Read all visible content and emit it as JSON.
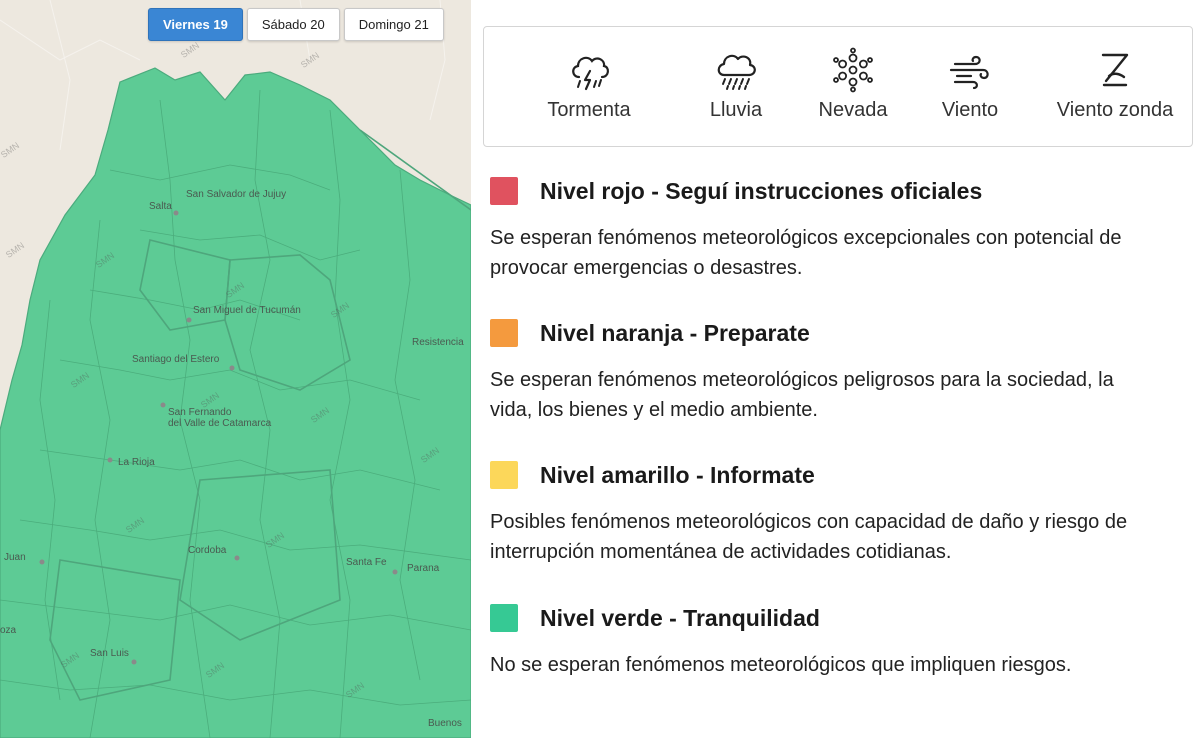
{
  "map": {
    "fill_color": "#5dcb95",
    "land_color": "#ede8df",
    "watermark": "SMN",
    "cities": [
      "San Salvador de Jujuy",
      "Salta",
      "San Miguel de Tucumán",
      "Resistencia",
      "Santiago del Estero",
      "San Fernando",
      "del Valle de Catamarca",
      "La Rioja",
      "Cordoba",
      "Santa Fe",
      "Parana",
      "Juan",
      "oza",
      "San Luis",
      "Buenos"
    ]
  },
  "date_tabs": [
    {
      "label": "Viernes 19",
      "active": true
    },
    {
      "label": "Sábado 20",
      "active": false
    },
    {
      "label": "Domingo 21",
      "active": false
    }
  ],
  "phenomena": [
    {
      "label": "Tormenta",
      "icon": "storm-icon"
    },
    {
      "label": "Lluvia",
      "icon": "rain-icon"
    },
    {
      "label": "Nevada",
      "icon": "snow-icon"
    },
    {
      "label": "Viento",
      "icon": "wind-icon"
    },
    {
      "label": "Viento zonda",
      "icon": "zonda-wind-icon"
    }
  ],
  "levels": [
    {
      "title": "Nivel rojo - Seguí instrucciones oficiales",
      "color": "#e0525f",
      "desc_line1": "Se esperan fenómenos meteorológicos excepcionales con potencial de",
      "desc_line2": "provocar emergencias o desastres."
    },
    {
      "title": "Nivel naranja - Preparate",
      "color": "#f49a3e",
      "desc_line1": "Se esperan fenómenos meteorológicos peligrosos para la sociedad, la",
      "desc_line2": "vida, los bienes y el medio ambiente."
    },
    {
      "title": "Nivel amarillo - Informate",
      "color": "#fcd75a",
      "desc_line1": "Posibles fenómenos meteorológicos con capacidad de daño y riesgo de",
      "desc_line2": "interrupción momentánea de actividades cotidianas."
    },
    {
      "title": "Nivel verde - Tranquilidad",
      "color": "#36c994",
      "desc_line1": "No se esperan fenómenos meteorológicos que impliquen riesgos.",
      "desc_line2": ""
    }
  ]
}
